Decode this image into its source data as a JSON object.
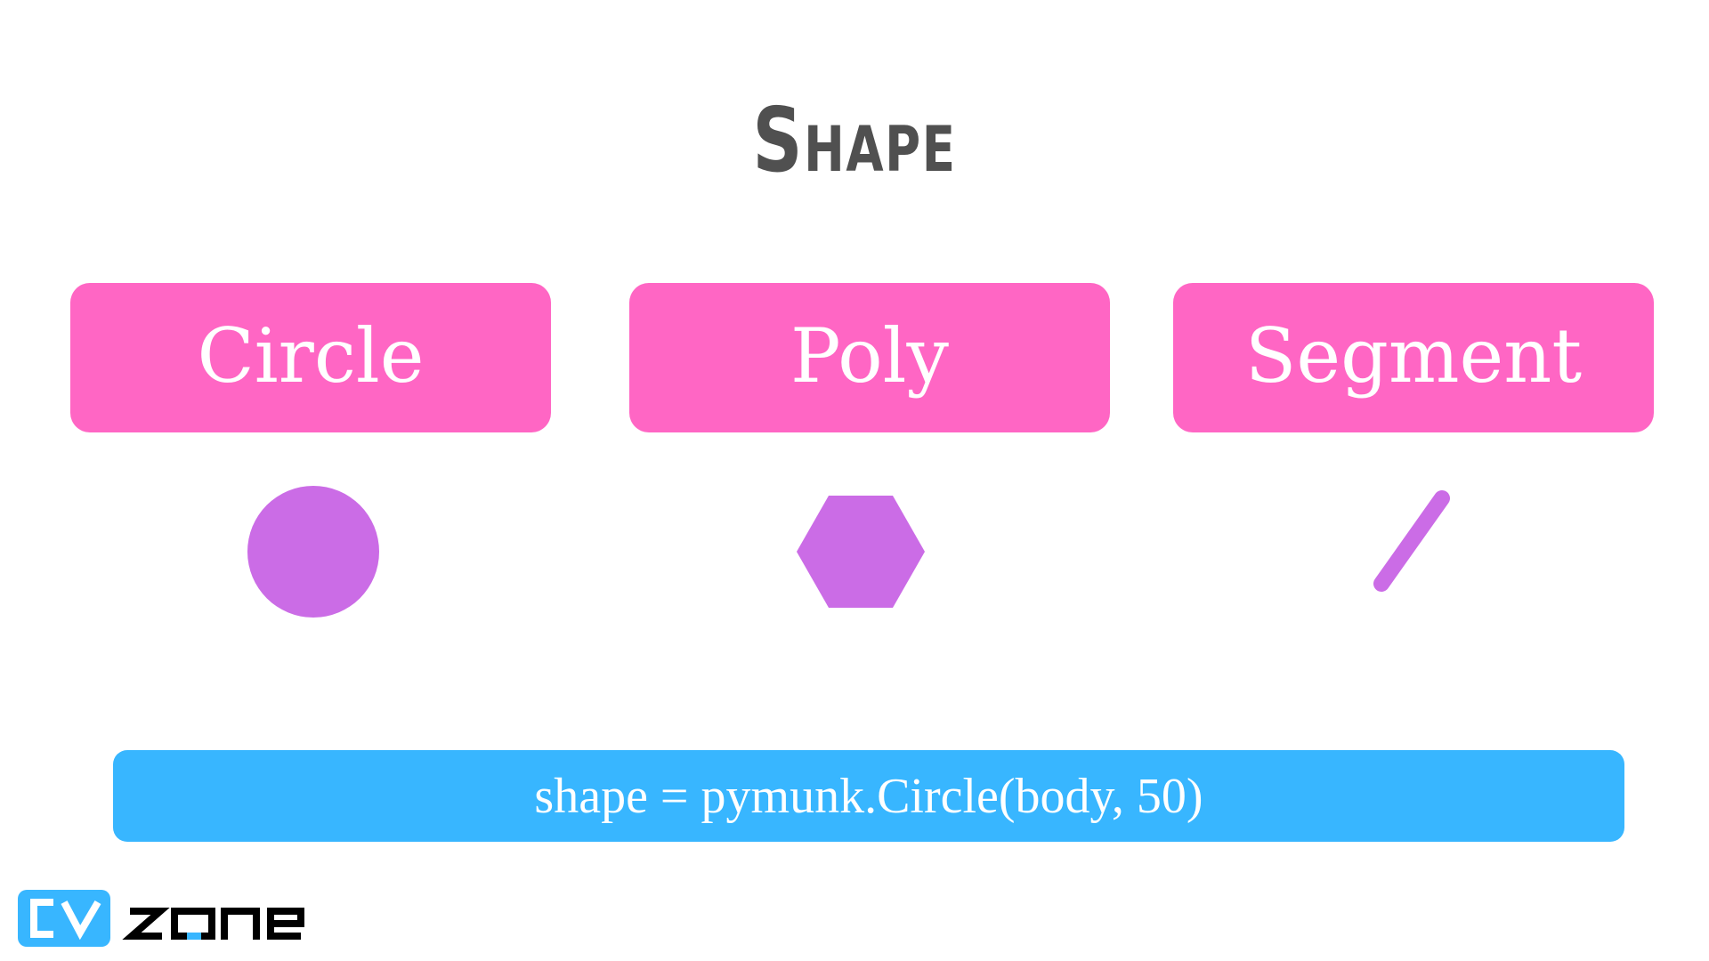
{
  "title": "Shape",
  "cards": [
    {
      "label": "Circle"
    },
    {
      "label": "Poly"
    },
    {
      "label": "Segment"
    }
  ],
  "glyphs": [
    {
      "icon": "circle-shape-icon"
    },
    {
      "icon": "hexagon-shape-icon"
    },
    {
      "icon": "segment-shape-icon"
    }
  ],
  "code": "shape = pymunk.Circle(body, 50)",
  "logo": {
    "text": "CVZONE"
  },
  "colors": {
    "title": "#505050",
    "card": "#ff66c4",
    "shape": "#cb6ce6",
    "code_bar": "#38b6ff",
    "logo_blue": "#38b6ff",
    "logo_dark": "#000000"
  }
}
